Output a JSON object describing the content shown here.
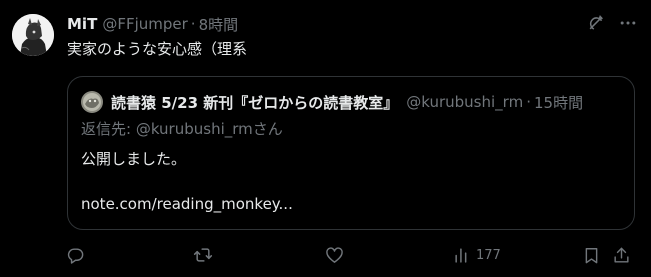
{
  "author": {
    "display_name": "MiT",
    "handle": "@FFjumper",
    "separator": "·",
    "time": "8時間"
  },
  "tweet": {
    "text": "実家のような安心感（理系"
  },
  "quoted": {
    "display_name": "読書猿 5/23 新刊『ゼロからの読書教室』",
    "handle": "@kurubushi_rm",
    "separator": "·",
    "time": "15時間",
    "reply_to": "返信先: @kurubushi_rmさん",
    "body_line1": "公開しました。",
    "body_line2": "note.com/reading_monkey..."
  },
  "actions": {
    "views_count": "177"
  },
  "icons": {
    "grok": "grok-icon",
    "more": "more-icon",
    "reply": "reply-icon",
    "retweet": "retweet-icon",
    "like": "like-icon",
    "views": "views-icon",
    "bookmark": "bookmark-icon",
    "share": "share-icon"
  },
  "colors": {
    "background": "#000000",
    "text_primary": "#e7e9ea",
    "text_secondary": "#71767b",
    "border": "#2f3336"
  }
}
